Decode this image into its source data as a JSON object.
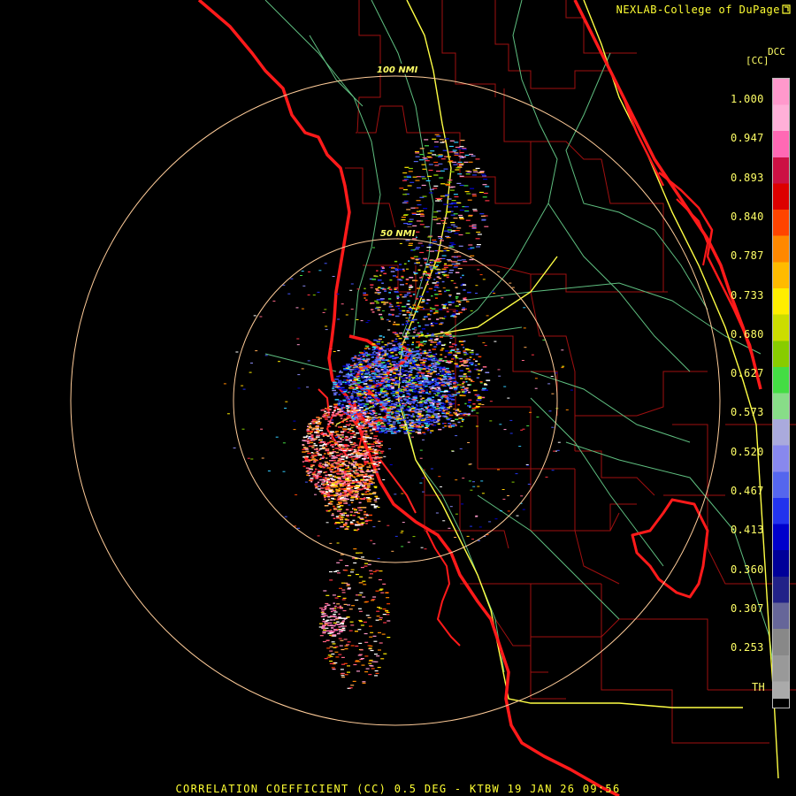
{
  "credit": "NEXLAB-College of DuPage",
  "legend": {
    "product_code": "DCC",
    "unit": "[CC]",
    "labels": [
      "1.000",
      "0.947",
      "0.893",
      "0.840",
      "0.787",
      "0.733",
      "0.680",
      "0.627",
      "0.573",
      "0.520",
      "0.467",
      "0.413",
      "0.360",
      "0.307",
      "0.253",
      "TH"
    ],
    "colors": [
      "#ff99cc",
      "#ffb0d8",
      "#ff69b4",
      "#cc1144",
      "#dd0000",
      "#ff4400",
      "#ff8800",
      "#ffbb00",
      "#ffee00",
      "#ccdd00",
      "#88cc00",
      "#44dd44",
      "#88dd88",
      "#aaaadd",
      "#8888ee",
      "#5566ee",
      "#2233ee",
      "#0000cc",
      "#000099",
      "#222288",
      "#666699",
      "#888888",
      "#999999",
      "#aaaaaa"
    ]
  },
  "range_rings": [
    {
      "label": "100 NMI"
    },
    {
      "label": "50 NMI"
    }
  ],
  "caption": "CORRELATION COEFFICIENT (CC) 0.5 DEG - KTBW 19 JAN 26 09:56",
  "map_colors": {
    "coastline": "#ff1a1a",
    "county": "#aa1111",
    "highway": "#ffff44",
    "road": "#66cc88",
    "ring": "#ffcc99"
  }
}
